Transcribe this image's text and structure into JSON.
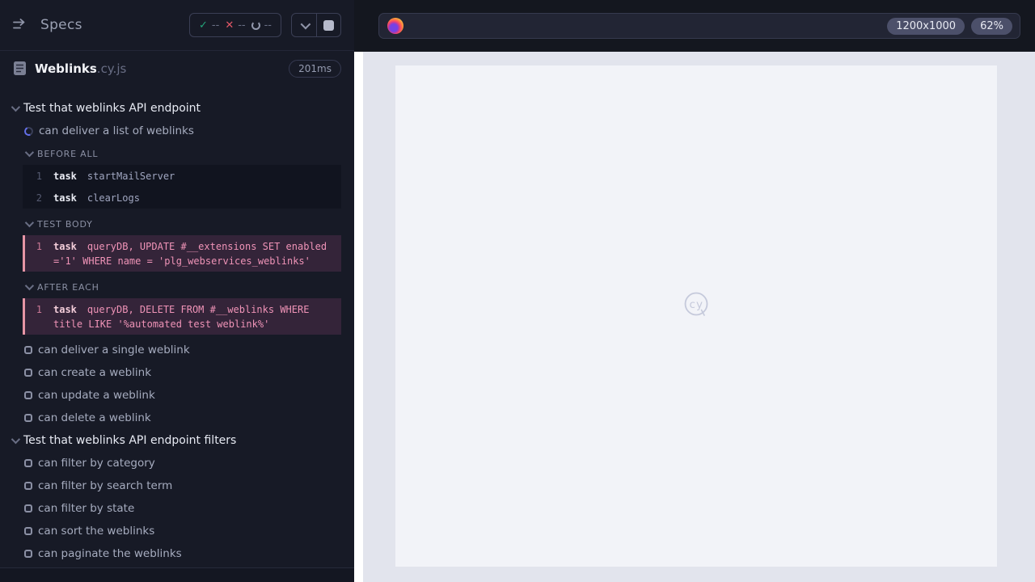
{
  "sidebar": {
    "title": "Specs",
    "stats": [
      {
        "icon": "check",
        "value": "--"
      },
      {
        "icon": "x",
        "value": "--"
      },
      {
        "icon": "running",
        "value": "--"
      }
    ],
    "spec": {
      "name": "Weblinks",
      "ext": ".cy.js",
      "duration": "201ms"
    },
    "suite1": {
      "label": "Test that weblinks API endpoint"
    },
    "running_test": {
      "label": "can deliver a list of weblinks"
    },
    "sections": {
      "before_all": {
        "label": "BEFORE ALL",
        "commands": [
          {
            "num": "1",
            "name": "task",
            "message": "startMailServer"
          },
          {
            "num": "2",
            "name": "task",
            "message": "clearLogs"
          }
        ]
      },
      "test_body": {
        "label": "TEST BODY",
        "commands": [
          {
            "num": "1",
            "name": "task",
            "message": "queryDB, UPDATE #__extensions SET enabled ='1' WHERE name = 'plg_webservices_weblinks'"
          }
        ]
      },
      "after_each": {
        "label": "AFTER EACH",
        "commands": [
          {
            "num": "1",
            "name": "task",
            "message": "queryDB, DELETE FROM #__weblinks WHERE title LIKE '%automated test weblink%'"
          }
        ]
      }
    },
    "tests1": [
      "can deliver a single weblink",
      "can create a weblink",
      "can update a weblink",
      "can delete a weblink"
    ],
    "suite2": {
      "label": "Test that weblinks API endpoint filters"
    },
    "tests2": [
      "can filter by category",
      "can filter by search term",
      "can filter by state",
      "can sort the weblinks",
      "can paginate the weblinks"
    ]
  },
  "viewport": {
    "url_value": "",
    "dimensions_badge": "1200x1000",
    "zoom_badge": "62%",
    "watermark": "cy"
  },
  "colors": {
    "sidebar_bg": "#171a26",
    "highlight_bg": "#342439",
    "highlight_border": "#e695a5",
    "highlight_text": "#ef93b7",
    "pass_green": "#23a47a",
    "fail_red": "#e25767",
    "spinner_blue": "#6470ea",
    "aut_bg": "#e2e4ed",
    "page_bg": "#f2f3f8"
  }
}
